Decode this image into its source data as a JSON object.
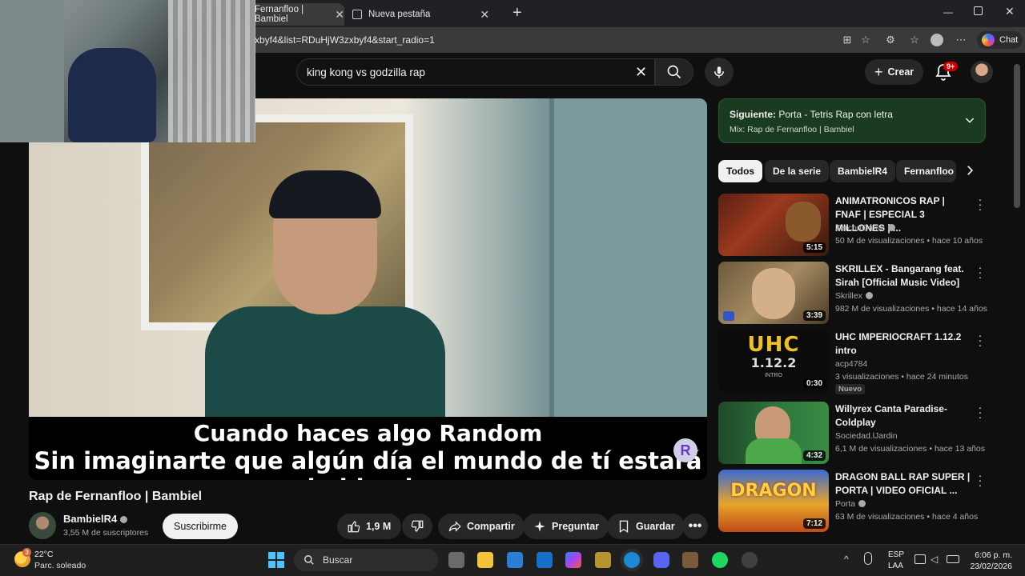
{
  "browser": {
    "tabs": [
      {
        "label": "Fernanfloo | Bambiel",
        "active": true
      },
      {
        "label": "Nueva pestaña",
        "active": false
      }
    ],
    "new_tab": "+",
    "url": "xbyf4&list=RDuHjW3zxbyf4&start_radio=1",
    "chat_label": "Chat",
    "window_controls": [
      "minimize-icon",
      "restore-icon",
      "close-icon"
    ]
  },
  "youtube_header": {
    "search_value": "king kong vs godzilla rap",
    "create_label": "Crear",
    "notification_count": "9+"
  },
  "player": {
    "subtitle_line1": "Cuando haces algo Random",
    "subtitle_line2": "Sin imaginarte que algún día el mundo de tí estará hablando",
    "watermark": "R"
  },
  "video": {
    "title": "Rap de Fernanfloo | Bambiel",
    "channel": "BambielR4",
    "subscribers": "3,55 M de suscriptores",
    "subscribe_label": "Suscribirme",
    "likes": "1,9 M",
    "share_label": "Compartir",
    "ask_label": "Preguntar",
    "save_label": "Guardar"
  },
  "up_next": {
    "label_prefix": "Siguiente:",
    "label_title": "Porta - Tetris Rap con letra",
    "mix": "Mix: Rap de Fernanfloo | Bambiel"
  },
  "chips": [
    "Todos",
    "De la serie",
    "BambielR4",
    "Fernanfloo"
  ],
  "related": [
    {
      "title": "ANIMATRONICOS RAP | FNAF | ESPECIAL 3 MILLONES | ...",
      "channel": "ZarcortGame",
      "verified": true,
      "views": "50 M de visualizaciones",
      "age": "hace 10 años",
      "duration": "5:15",
      "badge": ""
    },
    {
      "title": "SKRILLEX - Bangarang feat. Sirah [Official Music Video]",
      "channel": "Skrillex",
      "verified": true,
      "views": "982 M de visualizaciones",
      "age": "hace 14 años",
      "duration": "3:39",
      "badge": ""
    },
    {
      "title": "UHC IMPERIOCRAFT 1.12.2 intro",
      "channel": "acp4784",
      "verified": false,
      "views": "3 visualizaciones",
      "age": "hace 24 minutos",
      "duration": "0:30",
      "badge": "Nuevo"
    },
    {
      "title": "Willyrex Canta Paradise-Coldplay",
      "channel": "Sociedad.lJardin",
      "verified": false,
      "views": "6,1 M de visualizaciones",
      "age": "hace 13 años",
      "duration": "4:32",
      "badge": ""
    },
    {
      "title": "DRAGON BALL RAP SUPER | PORTA | VIDEO OFICIAL ...",
      "channel": "Porta",
      "verified": true,
      "views": "63 M de visualizaciones",
      "age": "hace 4 años",
      "duration": "7:12",
      "badge": ""
    }
  ],
  "thumb_text": {
    "uhc_big": "UHC",
    "uhc_version": "1.12.2",
    "uhc_sub": "INTRO",
    "dragon_big": "DRAGON"
  },
  "meta_separator": "•",
  "taskbar": {
    "temperature": "22°C",
    "weather": "Parc. soleado",
    "weather_alert": "3",
    "search_label": "Buscar",
    "language": "ESP",
    "layout": "LAA",
    "time": "6:06 p. m.",
    "date": "23/02/2026"
  },
  "colors": {
    "background": "#0f0f0f",
    "up_next_card": "#1a3a22",
    "accent_blue": "#4cc2ff",
    "notification_red": "#cc0000"
  }
}
